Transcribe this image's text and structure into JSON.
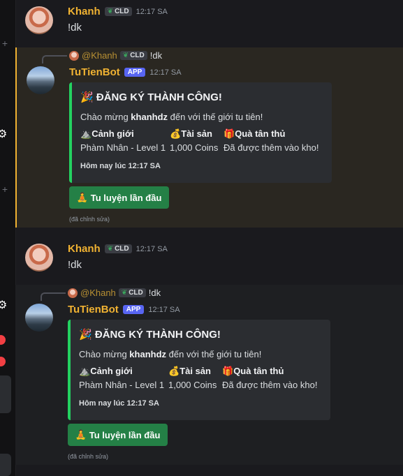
{
  "messages": [
    {
      "author": "Khanh",
      "tag": "CLD",
      "time": "12:17 SA",
      "content": "!dk"
    },
    {
      "reply": {
        "author": "@Khanh",
        "tag": "CLD",
        "text": "!dk"
      },
      "author": "TuTienBot",
      "app_tag": "APP",
      "time": "12:17 SA",
      "embed": {
        "title_icon": "🎉",
        "title": "ĐĂNG KÝ THÀNH CÔNG!",
        "desc_prefix": "Chào mừng ",
        "desc_user": "khanhdz",
        "desc_suffix": " đến với thế giới tu tiên!",
        "fields": [
          {
            "icon": "⛰️",
            "name": "Cảnh giới",
            "value": "Phàm Nhân - Level 1"
          },
          {
            "icon": "💰",
            "name": "Tài sản",
            "value": "1,000 Coins"
          },
          {
            "icon": "🎁",
            "name": "Quà tân thủ",
            "value": "Đã được thêm vào kho!"
          }
        ],
        "footer": "Hôm nay lúc 12:17 SA"
      },
      "button": {
        "icon": "🧘",
        "label": "Tu luyện lần đầu"
      },
      "edited": "(đã chỉnh sửa)"
    },
    {
      "author": "Khanh",
      "tag": "CLD",
      "time": "12:17 SA",
      "content": "!dk"
    },
    {
      "reply": {
        "author": "@Khanh",
        "tag": "CLD",
        "text": "!dk"
      },
      "author": "TuTienBot",
      "app_tag": "APP",
      "time": "12:17 SA",
      "embed": {
        "title_icon": "🎉",
        "title": "ĐĂNG KÝ THÀNH CÔNG!",
        "desc_prefix": "Chào mừng ",
        "desc_user": "khanhdz",
        "desc_suffix": " đến với thế giới tu tiên!",
        "fields": [
          {
            "icon": "⛰️",
            "name": "Cảnh giới",
            "value": "Phàm Nhân - Level 1"
          },
          {
            "icon": "💰",
            "name": "Tài sản",
            "value": "1,000 Coins"
          },
          {
            "icon": "🎁",
            "name": "Quà tân thủ",
            "value": "Đã được thêm vào kho!"
          }
        ],
        "footer": "Hôm nay lúc 12:17 SA"
      },
      "button": {
        "icon": "🧘",
        "label": "Tu luyện lần đầu"
      },
      "edited": "(đã chỉnh sửa)"
    }
  ],
  "colors": {
    "accent_green": "#248046",
    "embed_bar": "#23d160",
    "username": "#f0b232",
    "app_badge": "#5865f2"
  }
}
